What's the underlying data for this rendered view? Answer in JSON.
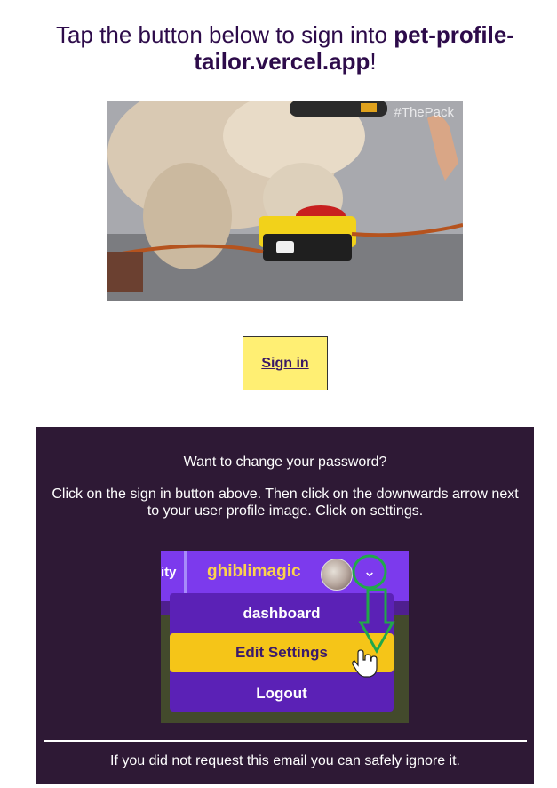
{
  "header": {
    "prefix": "Tap the button below to sign into ",
    "domain": "pet-profile-tailor.vercel.app",
    "suffix": "!"
  },
  "hero": {
    "watermark": "#ThePack"
  },
  "signin": {
    "label": "Sign in"
  },
  "panel": {
    "question": "Want to change your password?",
    "instructions": "Click on the sign in button above. Then click on the downwards arrow next to your user profile image. Click on settings.",
    "screenshot": {
      "tab_fragment": "ity",
      "username": "ghiblimagic",
      "menu_items": [
        "dashboard",
        "Edit Settings",
        "Logout"
      ]
    },
    "footer": "If you did not request this email you can safely ignore it."
  },
  "colors": {
    "heading": "#2d0b4a",
    "button_bg": "#ffef73",
    "panel_bg": "#2e1935",
    "menu_bg": "#5b21b6",
    "highlight": "#f5c518",
    "annotation": "#21a84a"
  }
}
